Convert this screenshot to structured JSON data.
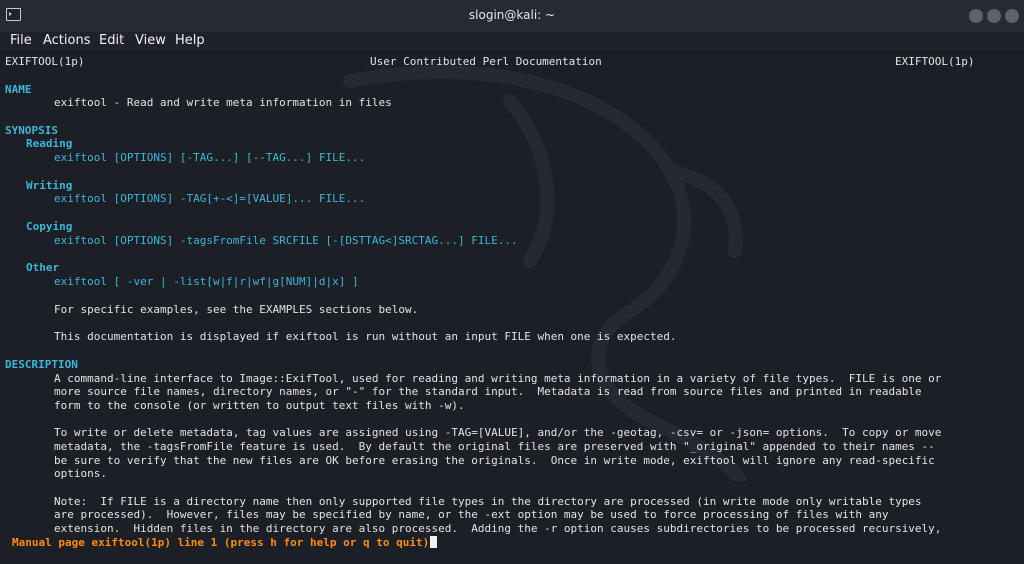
{
  "window": {
    "title": "slogin@kali: ~"
  },
  "menu": [
    "File",
    "Actions",
    "Edit",
    "View",
    "Help"
  ],
  "header": {
    "left": "EXIFTOOL(1p)",
    "center": "User Contributed Perl Documentation",
    "right": "EXIFTOOL(1p)"
  },
  "name_section": {
    "title": "NAME",
    "text": "exiftool - Read and write meta information in files"
  },
  "synopsis": {
    "title": "SYNOPSIS",
    "reading_title": "Reading",
    "reading_cmd": "exiftool [OPTIONS] [-TAG...] [--TAG...] FILE...",
    "writing_title": "Writing",
    "writing_cmd": "exiftool [OPTIONS] -TAG[+-<]=[VALUE]... FILE...",
    "copying_title": "Copying",
    "copying_cmd": "exiftool [OPTIONS] -tagsFromFile SRCFILE [-[DSTTAG<]SRCTAG...] FILE...",
    "other_title": "Other",
    "other_cmd": "exiftool [ -ver | -list[w|f|r|wf|g[NUM]|d|x] ]",
    "examples_note": "For specific examples, see the EXAMPLES sections below.",
    "display_note": "This documentation is displayed if exiftool is run without an input FILE when one is expected."
  },
  "description": {
    "title": "DESCRIPTION",
    "lines": [
      "A command-line interface to Image::ExifTool, used for reading and writing meta information in a variety of file types.  FILE is one or",
      "more source file names, directory names, or \"-\" for the standard input.  Metadata is read from source files and printed in readable",
      "form to the console (or written to output text files with -w).",
      "",
      "To write or delete metadata, tag values are assigned using -TAG=[VALUE], and/or the -geotag, -csv= or -json= options.  To copy or move",
      "metadata, the -tagsFromFile feature is used.  By default the original files are preserved with \"_original\" appended to their names --",
      "be sure to verify that the new files are OK before erasing the originals.  Once in write mode, exiftool will ignore any read-specific",
      "options.",
      "",
      "Note:  If FILE is a directory name then only supported file types in the directory are processed (in write mode only writable types",
      "are processed).  However, files may be specified by name, or the -ext option may be used to force processing of files with any",
      "extension.  Hidden files in the directory are also processed.  Adding the -r option causes subdirectories to be processed recursively,"
    ]
  },
  "status_line": "Manual page exiftool(1p) line 1 (press h for help or q to quit)",
  "colors": {
    "background": "#1c1f26",
    "titlebar": "#262a33",
    "text": "#e4e4e4",
    "accent_cyan": "#3fb6d9",
    "status_orange": "#ff8c1a"
  }
}
